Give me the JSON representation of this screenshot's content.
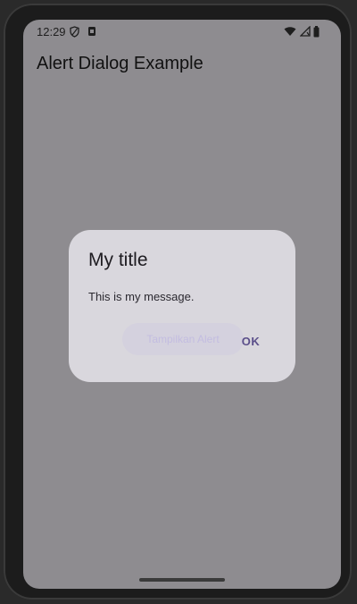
{
  "status": {
    "time": "12:29",
    "left_icons": [
      "shield-icon",
      "sim-icon"
    ],
    "right_icons": [
      "wifi-icon",
      "signal-icon",
      "battery-icon"
    ]
  },
  "appbar": {
    "title": "Alert Dialog Example"
  },
  "content": {
    "button_label": "Tampilkan Alert"
  },
  "dialog": {
    "title": "My title",
    "message": "This is my message.",
    "ok_label": "OK"
  },
  "colors": {
    "scrim": "#8e8c90",
    "dialog_bg": "#d9d7dd",
    "accent": "#5b4f8a"
  }
}
